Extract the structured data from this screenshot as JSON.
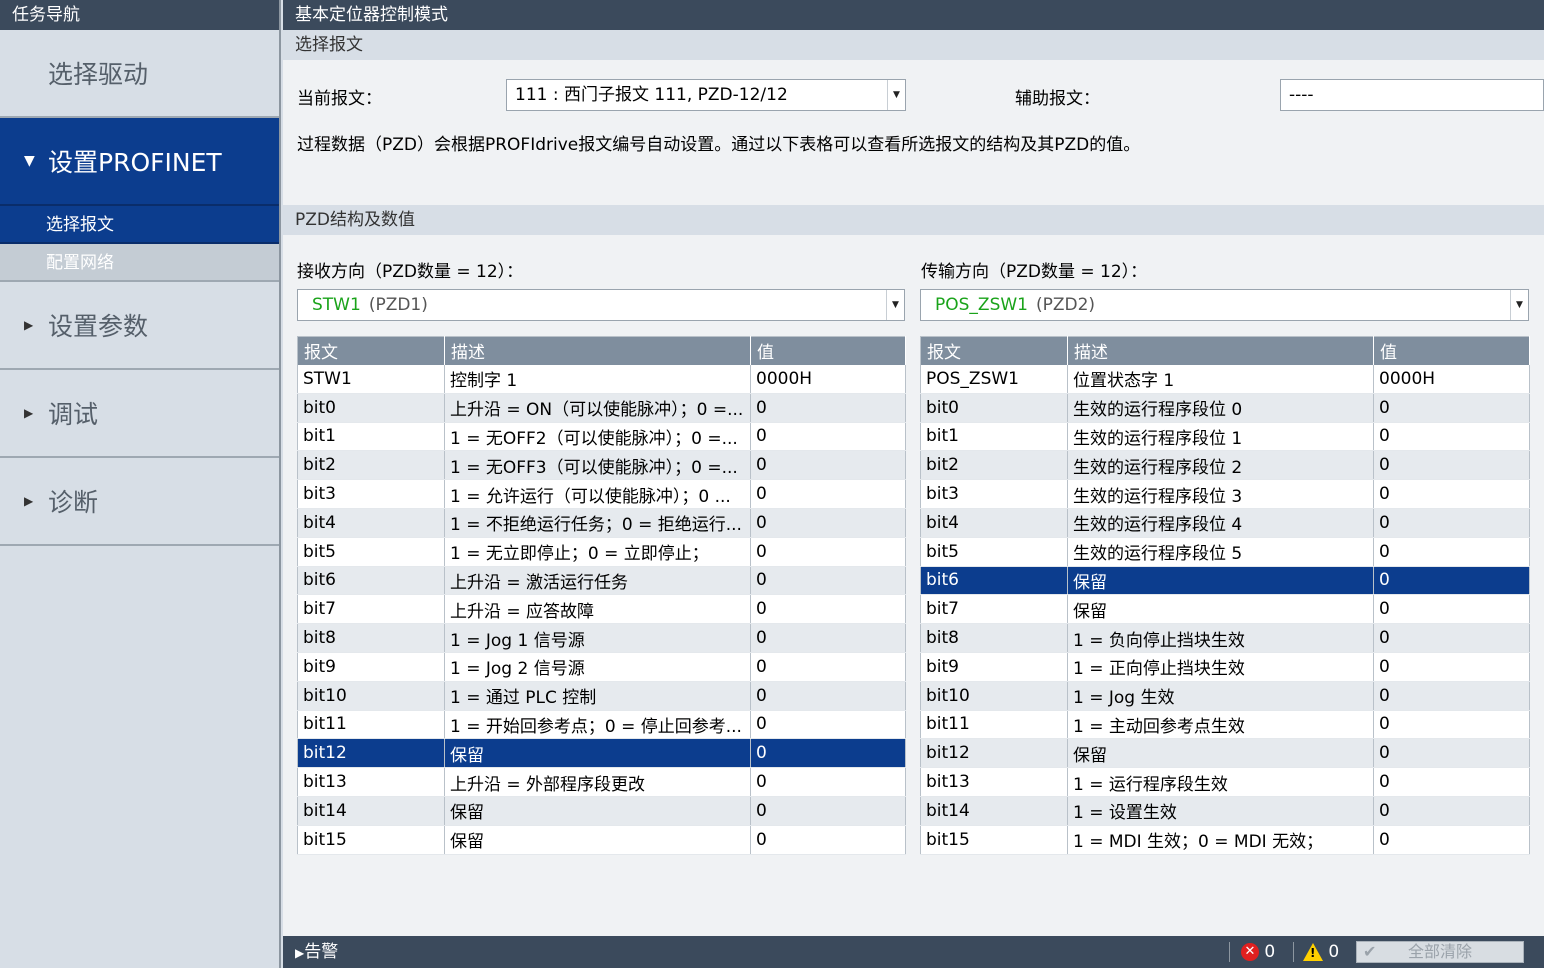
{
  "sidebar": {
    "title": "任务导航",
    "items": [
      {
        "label": "选择驱动"
      },
      {
        "label": "设置PROFINET"
      },
      {
        "label": "设置参数"
      },
      {
        "label": "调试"
      },
      {
        "label": "诊断"
      }
    ],
    "subitems": [
      {
        "label": "选择报文"
      },
      {
        "label": "配置网络"
      }
    ]
  },
  "main": {
    "title": "基本定位器控制模式",
    "section_telegram": "选择报文",
    "current_telegram_label": "当前报文：",
    "current_telegram_value": "111 : 西门子报文 111, PZD-12/12",
    "aux_telegram_label": "辅助报文：",
    "aux_telegram_value": "----",
    "info_text": "过程数据（PZD）会根据PROFIdrive报文编号自动设置。通过以下表格可以查看所选报文的结构及其PZD的值。",
    "section_pzd": "PZD结构及数值",
    "receive_label": "接收方向（PZD数量 = 12）：",
    "receive_signal": "STW1",
    "receive_pzd": "(PZD1)",
    "transmit_label": "传输方向（PZD数量 = 12）：",
    "transmit_signal": "POS_ZSW1",
    "transmit_pzd": "(PZD2)"
  },
  "table_headers": [
    "报文",
    "描述",
    "值"
  ],
  "receive_rows": [
    [
      "STW1",
      "控制字 1",
      "0000H"
    ],
    [
      "bit0",
      "上升沿 = ON（可以使能脉冲）；0 =...",
      "0"
    ],
    [
      "bit1",
      "1 = 无OFF2（可以使能脉冲）；0 =...",
      "0"
    ],
    [
      "bit2",
      "1 = 无OFF3（可以使能脉冲）；0 =...",
      "0"
    ],
    [
      "bit3",
      "1 = 允许运行（可以使能脉冲）；0 ...",
      "0"
    ],
    [
      "bit4",
      "1 = 不拒绝运行任务；0 = 拒绝运行...",
      "0"
    ],
    [
      "bit5",
      "1 = 无立即停止；0 = 立即停止；",
      "0"
    ],
    [
      "bit6",
      "上升沿 = 激活运行任务",
      "0"
    ],
    [
      "bit7",
      "上升沿 = 应答故障",
      "0"
    ],
    [
      "bit8",
      "1 = Jog 1 信号源",
      "0"
    ],
    [
      "bit9",
      "1 = Jog 2 信号源",
      "0"
    ],
    [
      "bit10",
      "1 = 通过 PLC 控制",
      "0"
    ],
    [
      "bit11",
      "1 = 开始回参考点；0 = 停止回参考...",
      "0"
    ],
    [
      "bit12",
      "保留",
      "0"
    ],
    [
      "bit13",
      "上升沿 = 外部程序段更改",
      "0"
    ],
    [
      "bit14",
      "保留",
      "0"
    ],
    [
      "bit15",
      "保留",
      "0"
    ]
  ],
  "receive_selected_row": 13,
  "transmit_rows": [
    [
      "POS_ZSW1",
      "位置状态字 1",
      "0000H"
    ],
    [
      "bit0",
      "生效的运行程序段位 0",
      "0"
    ],
    [
      "bit1",
      "生效的运行程序段位 1",
      "0"
    ],
    [
      "bit2",
      "生效的运行程序段位 2",
      "0"
    ],
    [
      "bit3",
      "生效的运行程序段位 3",
      "0"
    ],
    [
      "bit4",
      "生效的运行程序段位 4",
      "0"
    ],
    [
      "bit5",
      "生效的运行程序段位 5",
      "0"
    ],
    [
      "bit6",
      "保留",
      "0"
    ],
    [
      "bit7",
      "保留",
      "0"
    ],
    [
      "bit8",
      "1 = 负向停止挡块生效",
      "0"
    ],
    [
      "bit9",
      "1 = 正向停止挡块生效",
      "0"
    ],
    [
      "bit10",
      "1 = Jog 生效",
      "0"
    ],
    [
      "bit11",
      "1 = 主动回参考点生效",
      "0"
    ],
    [
      "bit12",
      "保留",
      "0"
    ],
    [
      "bit13",
      "1 = 运行程序段生效",
      "0"
    ],
    [
      "bit14",
      "1 = 设置生效",
      "0"
    ],
    [
      "bit15",
      "1 = MDI 生效；0 = MDI 无效；",
      "0"
    ]
  ],
  "transmit_selected_row": 7,
  "statusbar": {
    "alarm_label": "告警",
    "error_count": "0",
    "warning_count": "0",
    "clear_all_label": "全部清除"
  },
  "colors": {
    "selected_row": "#0c3d8e",
    "header_bar": "#3b4a5c",
    "signal_green": "#1aa31a"
  }
}
